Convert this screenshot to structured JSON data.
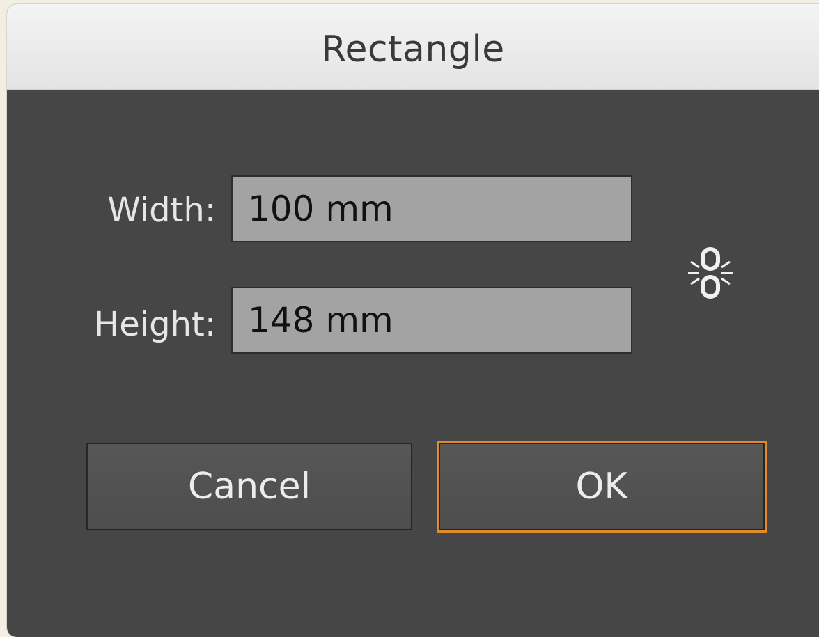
{
  "dialog": {
    "title": "Rectangle",
    "width_label": "Width:",
    "width_value": "100 mm",
    "height_label": "Height:",
    "height_value": "148 mm",
    "constrain_icon": "chain-link-icon",
    "cancel_label": "Cancel",
    "ok_label": "OK"
  },
  "colors": {
    "background": "#464646",
    "focus_ring": "#e08a2e",
    "field": "#a3a3a3"
  }
}
